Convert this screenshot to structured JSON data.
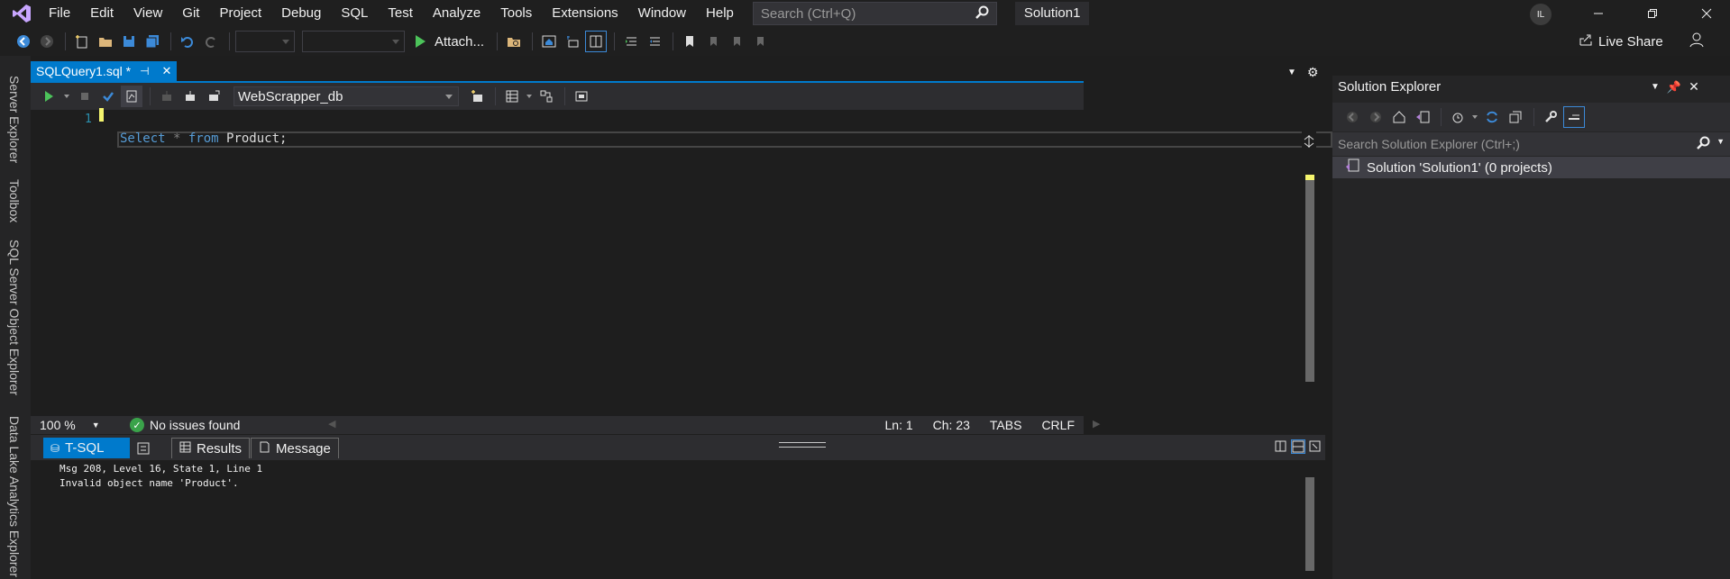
{
  "menu": {
    "items": [
      "File",
      "Edit",
      "View",
      "Git",
      "Project",
      "Debug",
      "SQL",
      "Test",
      "Analyze",
      "Tools",
      "Extensions",
      "Window",
      "Help"
    ],
    "search_placeholder": "Search (Ctrl+Q)",
    "solution_name": "Solution1",
    "user_initials": "IL"
  },
  "toolbar": {
    "attach_label": "Attach...",
    "live_share_label": "Live Share"
  },
  "side_strip": {
    "tabs": [
      "Server Explorer",
      "Toolbox",
      "SQL Server Object Explorer",
      "Data Lake Analytics Explorer"
    ]
  },
  "editor": {
    "tab_label": "SQLQuery1.sql *",
    "database": "WebScrapper_db",
    "line_number": "1",
    "code": {
      "kw1": "Select",
      "star": " * ",
      "kw2": "from",
      "rest": " Product;"
    }
  },
  "status": {
    "zoom": "100 %",
    "issues": "No issues found",
    "line": "Ln: 1",
    "col": "Ch: 23",
    "tabs": "TABS",
    "eol": "CRLF"
  },
  "results": {
    "tabs": [
      "T-SQL",
      "Results",
      "Message"
    ],
    "messages": [
      "Msg 208, Level 16, State 1, Line 1",
      "Invalid object name 'Product'."
    ]
  },
  "solution_explorer": {
    "title": "Solution Explorer",
    "search_placeholder": "Search Solution Explorer (Ctrl+;)",
    "root_item": "Solution 'Solution1' (0 projects)"
  },
  "colors": {
    "accent": "#007acc",
    "keyword": "#569cd6",
    "line_number": "#2b91af",
    "ok": "#3aa34a"
  }
}
